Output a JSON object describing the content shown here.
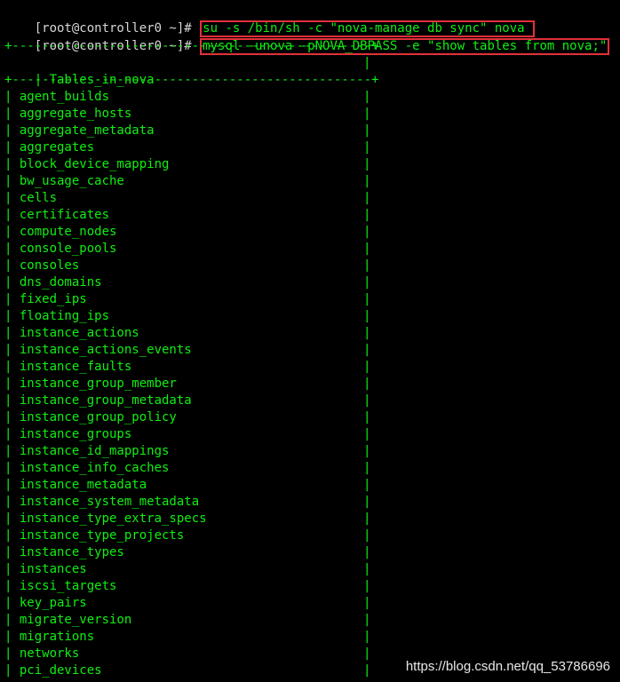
{
  "terminal": {
    "prompt": "[root@controller0 ~]# ",
    "commands": [
      "su -s /bin/sh -c \"nova-manage db sync\" nova ",
      "mysql -unova -pNOVA_DBPASS -e \"show tables from nova;\""
    ],
    "separator": "+------------------------------------------------+",
    "header": "Tables_in_nova",
    "tables": [
      "agent_builds",
      "aggregate_hosts",
      "aggregate_metadata",
      "aggregates",
      "block_device_mapping",
      "bw_usage_cache",
      "cells",
      "certificates",
      "compute_nodes",
      "console_pools",
      "consoles",
      "dns_domains",
      "fixed_ips",
      "floating_ips",
      "instance_actions",
      "instance_actions_events",
      "instance_faults",
      "instance_group_member",
      "instance_group_metadata",
      "instance_group_policy",
      "instance_groups",
      "instance_id_mappings",
      "instance_info_caches",
      "instance_metadata",
      "instance_system_metadata",
      "instance_type_extra_specs",
      "instance_type_projects",
      "instance_types",
      "instances",
      "iscsi_targets",
      "key_pairs",
      "migrate_version",
      "migrations",
      "networks",
      "pci_devices"
    ]
  },
  "watermark": "https://blog.csdn.net/qq_53786696",
  "colors": {
    "background": "#000000",
    "output_text": "#11ee11",
    "prompt_text": "#d6d6d6",
    "highlight_box": "#e3303a"
  }
}
